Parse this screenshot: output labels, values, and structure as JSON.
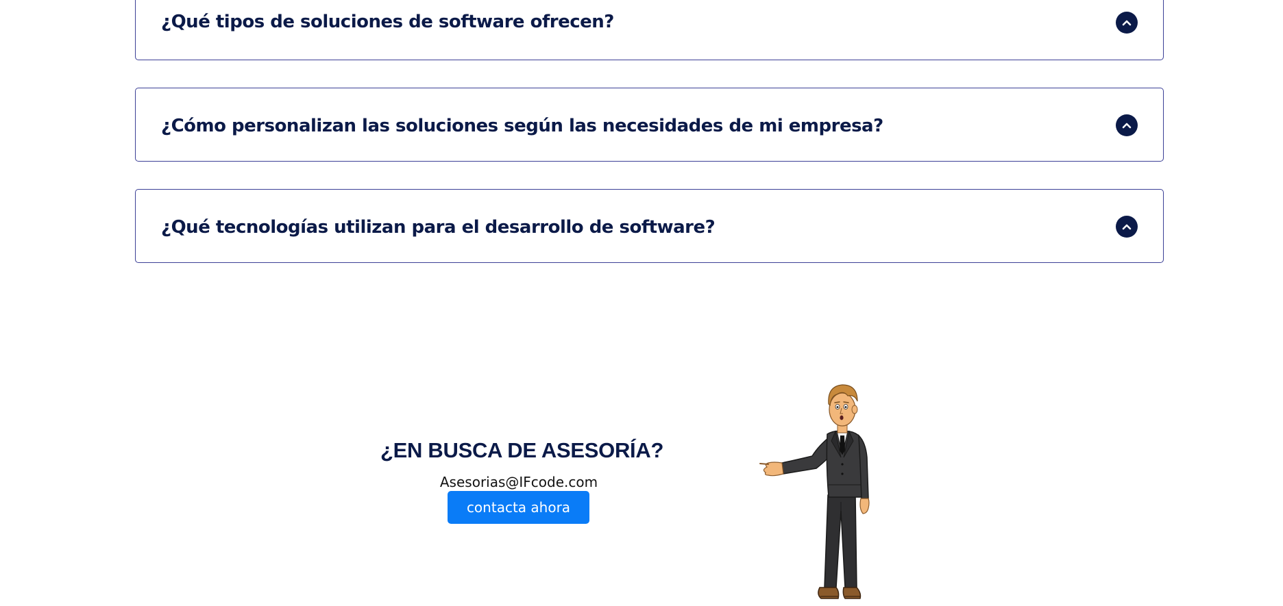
{
  "faq": [
    {
      "question": "¿Qué tipos de soluciones de software ofrecen?",
      "toggle_icon": "chevron-up-icon"
    },
    {
      "question": "¿Cómo personalizan las soluciones según las necesidades de mi empresa?",
      "toggle_icon": "chevron-up-icon"
    },
    {
      "question": "¿Qué tecnologías utilizan para el desarrollo de software?",
      "toggle_icon": "chevron-up-icon"
    }
  ],
  "cta": {
    "title": "¿EN BUSCA DE ASESORÍA?",
    "email": "Asesorias@IFcode.com",
    "button_label": "contacta ahora"
  },
  "illustration": {
    "subject": "businessman-presenting-illustration"
  },
  "colors": {
    "navy": "#0b1a48",
    "border": "#3b3f96",
    "button_blue": "#0a7cf7",
    "background": "#ffffff"
  }
}
